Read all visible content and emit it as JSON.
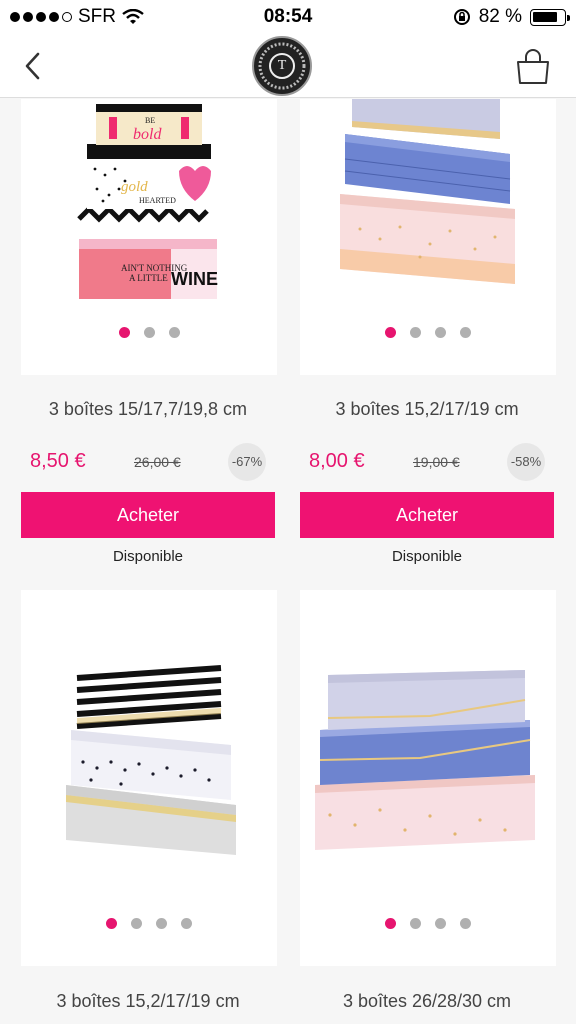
{
  "status_bar": {
    "carrier": "SFR",
    "time": "08:54",
    "battery_percent": "82 %",
    "battery_level": 0.82
  },
  "nav": {
    "back_icon": "chevron-left-icon",
    "logo_letter": "T",
    "cart_icon": "shopping-bag-icon"
  },
  "colors": {
    "accent": "#ef1272",
    "price": "#e6156f"
  },
  "products": [
    {
      "title": "3 boîtes 15/17,7/19,8 cm",
      "price": "8,50 €",
      "old_price": "26,00 €",
      "discount": "-67%",
      "buy_label": "Acheter",
      "availability": "Disponible",
      "image_texts": [
        "BE",
        "bold",
        "gold",
        "HEARTED",
        "AIN'T NOTHING",
        "A LITTLE",
        "WINE"
      ],
      "carousel_count": 3,
      "carousel_active": 0
    },
    {
      "title": "3 boîtes 15,2/17/19 cm",
      "price": "8,00 €",
      "old_price": "19,00 €",
      "discount": "-58%",
      "buy_label": "Acheter",
      "availability": "Disponible",
      "carousel_count": 4,
      "carousel_active": 0
    },
    {
      "title": "3 boîtes 15,2/17/19 cm",
      "carousel_count": 4,
      "carousel_active": 0
    },
    {
      "title": "3 boîtes 26/28/30 cm",
      "carousel_count": 4,
      "carousel_active": 0
    }
  ]
}
